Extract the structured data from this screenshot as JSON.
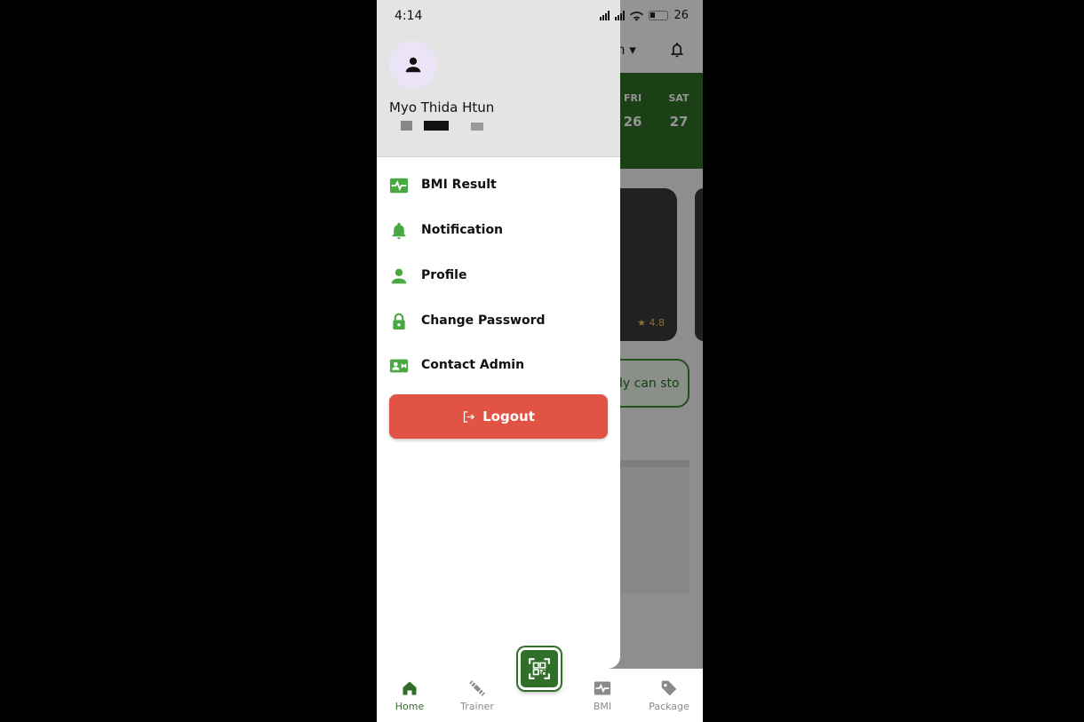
{
  "status_bar": {
    "time": "4:14",
    "network": "4G",
    "battery": "26"
  },
  "background": {
    "days": [
      {
        "name": "FRI",
        "date": "26"
      },
      {
        "name": "SAT",
        "date": "27"
      }
    ],
    "rating": "4.8",
    "quote_snippet": "dy can sto"
  },
  "drawer": {
    "user_name": "Myo Thida Htun",
    "menu": [
      {
        "label": "BMI Result",
        "icon": "monitor-heart-icon"
      },
      {
        "label": "Notification",
        "icon": "bell-icon"
      },
      {
        "label": "Profile",
        "icon": "person-icon"
      },
      {
        "label": "Change Password",
        "icon": "lock-icon"
      },
      {
        "label": "Contact Admin",
        "icon": "contact-card-icon"
      }
    ],
    "logout_label": "Logout"
  },
  "bottom_nav": {
    "items": [
      {
        "label": "Home",
        "icon": "home-icon",
        "active": true
      },
      {
        "label": "Trainer",
        "icon": "dumbbell-icon",
        "active": false
      },
      {
        "label": "BMI",
        "icon": "monitor-heart-icon",
        "active": false
      },
      {
        "label": "Package",
        "icon": "tag-icon",
        "active": false
      }
    ]
  },
  "colors": {
    "brand_green": "#2f6f27",
    "icon_green": "#4aa843",
    "logout_red": "#e05345",
    "avatar_bg": "#ebe3f8"
  }
}
